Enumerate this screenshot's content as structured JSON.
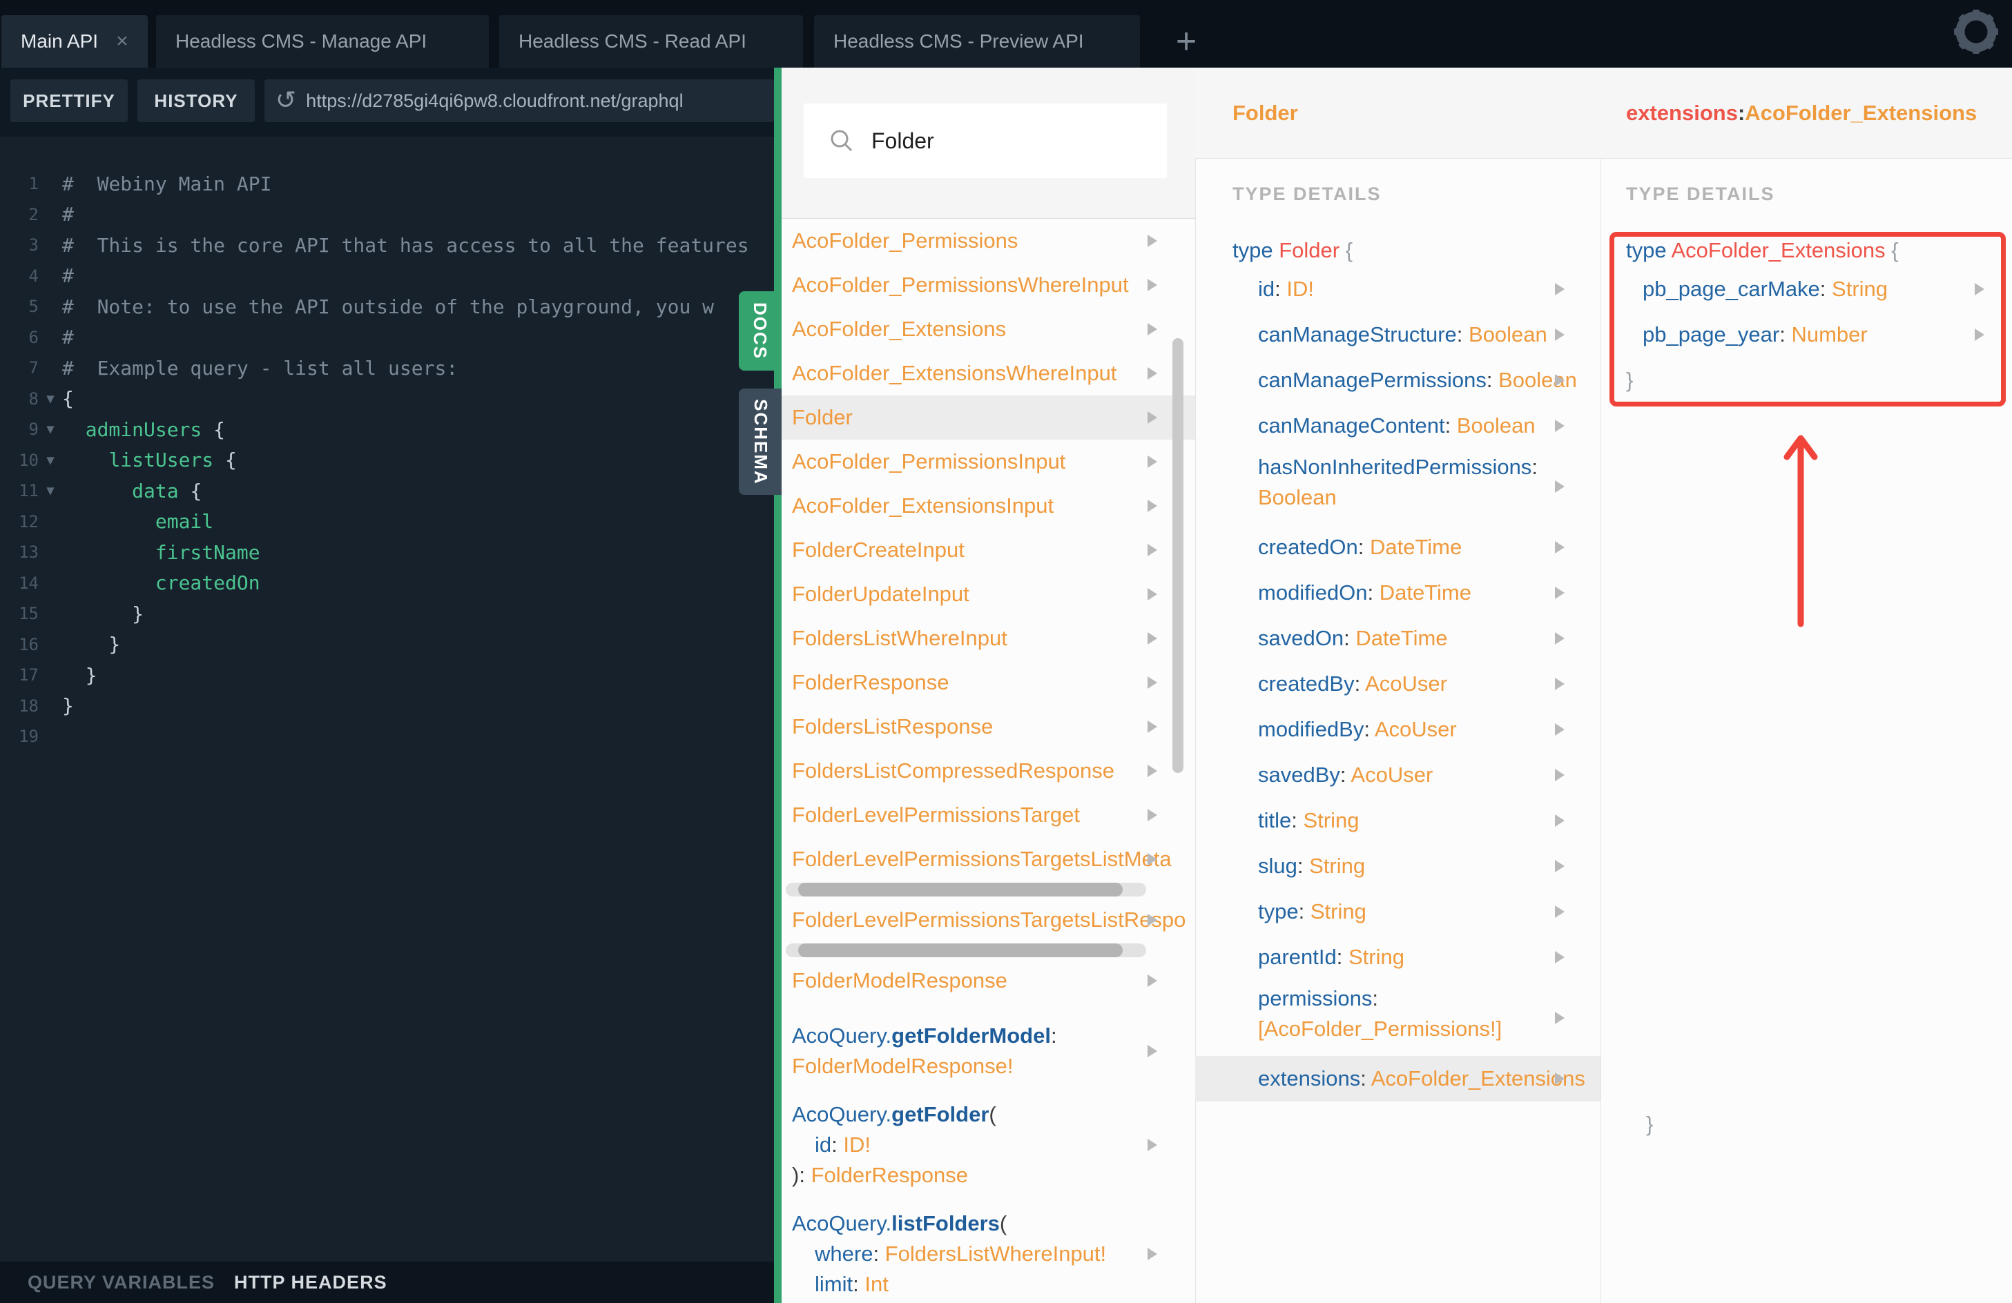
{
  "window": {
    "tabs": [
      {
        "label": "Main API",
        "active": true,
        "closable": true
      },
      {
        "label": "Headless CMS - Manage API",
        "active": false,
        "closable": false
      },
      {
        "label": "Headless CMS - Read API",
        "active": false,
        "closable": false
      },
      {
        "label": "Headless CMS - Preview API",
        "active": false,
        "closable": false
      }
    ],
    "add_tab_label": "+",
    "close_tab_label": "×",
    "gear_icon": "settings-gear"
  },
  "toolbar": {
    "prettify_label": "PRETTIFY",
    "history_label": "HISTORY",
    "url": "https://d2785gi4qi6pw8.cloudfront.net/graphql",
    "reload_icon": "↺"
  },
  "editor": {
    "lines": [
      {
        "n": "1",
        "fold": false,
        "segments": [
          {
            "t": "#  Webiny Main API",
            "c": "comment"
          }
        ]
      },
      {
        "n": "2",
        "fold": false,
        "segments": [
          {
            "t": "#",
            "c": "comment"
          }
        ]
      },
      {
        "n": "3",
        "fold": false,
        "segments": [
          {
            "t": "#  This is the core API that has access to all the features",
            "c": "comment"
          }
        ]
      },
      {
        "n": "4",
        "fold": false,
        "segments": [
          {
            "t": "#",
            "c": "comment"
          }
        ]
      },
      {
        "n": "5",
        "fold": false,
        "segments": [
          {
            "t": "#  Note: to use the API outside of the playground, you w",
            "c": "comment"
          }
        ]
      },
      {
        "n": "6",
        "fold": false,
        "segments": [
          {
            "t": "#",
            "c": "comment"
          }
        ]
      },
      {
        "n": "7",
        "fold": false,
        "segments": [
          {
            "t": "#  Example query - list all users:",
            "c": "comment"
          }
        ]
      },
      {
        "n": "8",
        "fold": true,
        "segments": [
          {
            "t": "{",
            "c": "punct"
          }
        ]
      },
      {
        "n": "9",
        "fold": true,
        "segments": [
          {
            "t": "  ",
            "c": "punct"
          },
          {
            "t": "adminUsers",
            "c": "prop"
          },
          {
            "t": " {",
            "c": "punct"
          }
        ]
      },
      {
        "n": "10",
        "fold": true,
        "segments": [
          {
            "t": "    ",
            "c": "punct"
          },
          {
            "t": "listUsers",
            "c": "prop"
          },
          {
            "t": " {",
            "c": "punct"
          }
        ]
      },
      {
        "n": "11",
        "fold": true,
        "segments": [
          {
            "t": "      ",
            "c": "punct"
          },
          {
            "t": "data",
            "c": "prop"
          },
          {
            "t": " {",
            "c": "punct"
          }
        ]
      },
      {
        "n": "12",
        "fold": false,
        "segments": [
          {
            "t": "        ",
            "c": "punct"
          },
          {
            "t": "email",
            "c": "prop"
          }
        ]
      },
      {
        "n": "13",
        "fold": false,
        "segments": [
          {
            "t": "        ",
            "c": "punct"
          },
          {
            "t": "firstName",
            "c": "prop"
          }
        ]
      },
      {
        "n": "14",
        "fold": false,
        "segments": [
          {
            "t": "        ",
            "c": "punct"
          },
          {
            "t": "createdOn",
            "c": "prop"
          }
        ]
      },
      {
        "n": "15",
        "fold": false,
        "segments": [
          {
            "t": "      }",
            "c": "punct"
          }
        ]
      },
      {
        "n": "16",
        "fold": false,
        "segments": [
          {
            "t": "    }",
            "c": "punct"
          }
        ]
      },
      {
        "n": "17",
        "fold": false,
        "segments": [
          {
            "t": "  }",
            "c": "punct"
          }
        ]
      },
      {
        "n": "18",
        "fold": false,
        "segments": [
          {
            "t": "}",
            "c": "punct"
          }
        ]
      },
      {
        "n": "19",
        "fold": false,
        "segments": []
      }
    ]
  },
  "bottom_bar": {
    "query_variables_label": "QUERY VARIABLES",
    "http_headers_label": "HTTP HEADERS"
  },
  "side_tabs": {
    "docs_label": "DOCS",
    "schema_label": "SCHEMA"
  },
  "docs": {
    "search": {
      "value": "Folder",
      "icon": "search-magnifier"
    },
    "type_list": [
      {
        "name": "AcoFolder_Permissions"
      },
      {
        "name": "AcoFolder_PermissionsWhereInput"
      },
      {
        "name": "AcoFolder_Extensions"
      },
      {
        "name": "AcoFolder_ExtensionsWhereInput"
      },
      {
        "name": "Folder",
        "highlighted": true
      },
      {
        "name": "AcoFolder_PermissionsInput"
      },
      {
        "name": "AcoFolder_ExtensionsInput"
      },
      {
        "name": "FolderCreateInput"
      },
      {
        "name": "FolderUpdateInput"
      },
      {
        "name": "FoldersListWhereInput"
      },
      {
        "name": "FolderResponse"
      },
      {
        "name": "FoldersListResponse"
      },
      {
        "name": "FoldersListCompressedResponse"
      },
      {
        "name": "FolderLevelPermissionsTarget"
      },
      {
        "name": "FolderLevelPermissionsTargetsListMeta",
        "hscroll_after": true
      },
      {
        "name": "FolderLevelPermissionsTargetsListRespo",
        "hscroll_after": true
      },
      {
        "name": "FolderModelResponse"
      }
    ],
    "query_entries": [
      {
        "lines": [
          [
            {
              "t": "AcoQuery.",
              "c": "b"
            },
            {
              "t": "getFolderModel",
              "c": "bb"
            },
            {
              "t": ":",
              "c": "p"
            }
          ],
          [
            {
              "t": "FolderModelResponse!",
              "c": "o"
            }
          ]
        ]
      },
      {
        "lines": [
          [
            {
              "t": "AcoQuery.",
              "c": "b"
            },
            {
              "t": "getFolder",
              "c": "bb"
            },
            {
              "t": "(",
              "c": "p"
            }
          ],
          [
            {
              "t": "id",
              "c": "b",
              "ind": true
            },
            {
              "t": ": ",
              "c": "p"
            },
            {
              "t": "ID!",
              "c": "o"
            }
          ],
          [
            {
              "t": "): ",
              "c": "p"
            },
            {
              "t": "FolderResponse",
              "c": "o"
            }
          ]
        ]
      },
      {
        "lines": [
          [
            {
              "t": "AcoQuery.",
              "c": "b"
            },
            {
              "t": "listFolders",
              "c": "bb"
            },
            {
              "t": "(",
              "c": "p"
            }
          ],
          [
            {
              "t": "where",
              "c": "b",
              "ind": true
            },
            {
              "t": ": ",
              "c": "p"
            },
            {
              "t": "FoldersListWhereInput!",
              "c": "o"
            }
          ],
          [
            {
              "t": "limit",
              "c": "b",
              "ind": true
            },
            {
              "t": ": ",
              "c": "p"
            },
            {
              "t": "Int",
              "c": "o"
            }
          ]
        ]
      }
    ],
    "folder_panel": {
      "title": "Folder",
      "section_label": "TYPE DETAILS",
      "declaration": [
        {
          "t": "type ",
          "c": "b"
        },
        {
          "t": "Folder ",
          "c": "r"
        },
        {
          "t": "{",
          "c": "g"
        }
      ],
      "fields": [
        {
          "name": "id",
          "type": "ID!"
        },
        {
          "name": "canManageStructure",
          "type": "Boolean"
        },
        {
          "name": "canManagePermissions",
          "type": "Boolean"
        },
        {
          "name": "canManageContent",
          "type": "Boolean"
        },
        {
          "name": "hasNonInheritedPermissions",
          "type": "Boolean",
          "two_line": true
        },
        {
          "name": "createdOn",
          "type": "DateTime"
        },
        {
          "name": "modifiedOn",
          "type": "DateTime"
        },
        {
          "name": "savedOn",
          "type": "DateTime"
        },
        {
          "name": "createdBy",
          "type": "AcoUser"
        },
        {
          "name": "modifiedBy",
          "type": "AcoUser"
        },
        {
          "name": "savedBy",
          "type": "AcoUser"
        },
        {
          "name": "title",
          "type": "String"
        },
        {
          "name": "slug",
          "type": "String"
        },
        {
          "name": "type",
          "type": "String"
        },
        {
          "name": "parentId",
          "type": "String"
        },
        {
          "name": "permissions",
          "type": "[AcoFolder_Permissions!]",
          "two_line": true
        },
        {
          "name": "extensions",
          "type": "AcoFolder_Extensions",
          "highlighted": true
        }
      ],
      "close_brace": "}"
    },
    "extensions_panel": {
      "title_segments": [
        {
          "t": "extensions",
          "c": "r"
        },
        {
          "t": ": ",
          "c": "p"
        },
        {
          "t": "AcoFolder_Extensions",
          "c": "o"
        }
      ],
      "section_label": "TYPE DETAILS",
      "declaration": [
        {
          "t": "type ",
          "c": "b"
        },
        {
          "t": "AcoFolder_Extensions ",
          "c": "r"
        },
        {
          "t": "{",
          "c": "g"
        }
      ],
      "fields": [
        {
          "name": "pb_page_carMake",
          "type": "String"
        },
        {
          "name": "pb_page_year",
          "type": "Number"
        }
      ],
      "close_brace": "}",
      "annotations": {
        "red_box": true,
        "red_arrow_up": true
      }
    }
  },
  "colors": {
    "accent_green": "#34a36e",
    "schema_tab": "#3d4c5b",
    "orange_type": "#ef9a3d",
    "blue_field": "#2365a3",
    "red_typename": "#ee5449",
    "annotation_red": "#f0443b",
    "row_highlight": "#ececec",
    "editor_bg": "#16212c",
    "tabbar_bg": "#0a1119",
    "code_green": "#4bc48f"
  }
}
